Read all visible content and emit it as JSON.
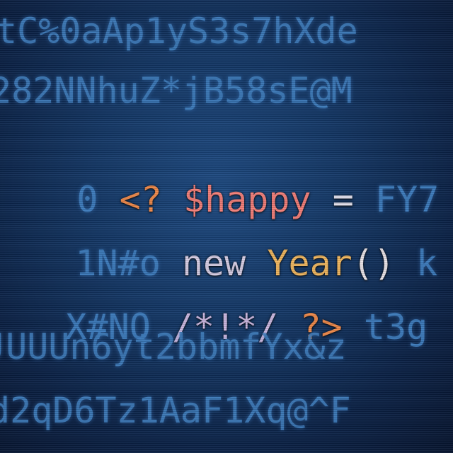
{
  "background_lines": [
    "tC%0aAp1yS3s7hXde",
    "282NNhuZ*jB58sE@M",
    "JUUUn6yt2bbmfYx&z",
    "d2qD6Tz1AaF1Xq@^F"
  ],
  "highlight_lines": [
    {
      "lead": "0 ",
      "code_a": "<?",
      "code_b": " ",
      "code_c": "$happy",
      "code_d": " = ",
      "tail": "FY7"
    },
    {
      "lead": "1N#o ",
      "code_a": "new",
      "code_b": " ",
      "code_c": "Year",
      "code_d": "() ",
      "tail": "k"
    },
    {
      "lead": "X#NQ ",
      "code_a": "/*!*/",
      "code_b": " ",
      "code_c": "?>",
      "code_d": " ",
      "tail": "t3g"
    }
  ],
  "colors": {
    "background": "#133766",
    "dim_text": "#3f7fc0",
    "php_tag": "#f08a4b",
    "variable": "#f47f79",
    "keyword": "#d8cfe6",
    "class_name": "#f2b860"
  }
}
